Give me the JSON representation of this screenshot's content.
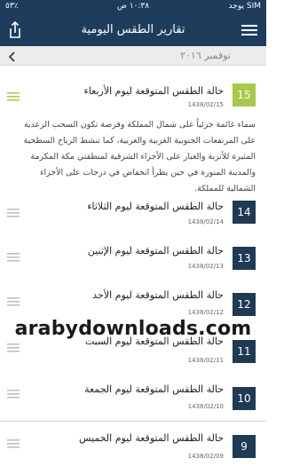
{
  "status_bar": {
    "carrier": "يوجد SIM",
    "time": "١٠:٣٨ ص",
    "battery": "٥٣٪"
  },
  "header": {
    "title": "تقارير الطقس اليومية",
    "share_icon": "share-icon",
    "menu_icon": "hamburger-menu-icon"
  },
  "month_nav": {
    "label": "نوفمبر ٢٠١٦",
    "prev_icon": "chevron-left-icon"
  },
  "colors": {
    "header_bg": "#1e3d5c",
    "active_badge": "#a9c94a",
    "badge": "#1f3a55"
  },
  "items": [
    {
      "day": "15",
      "title": "حالة الطقس المتوقعة ليوم الأربعاء",
      "date": "1438/02/15",
      "active": true
    },
    {
      "day": "14",
      "title": "حالة الطقس المتوقعة ليوم الثلاثاء",
      "date": "1438/02/14"
    },
    {
      "day": "13",
      "title": "حالة الطقس المتوقعة ليوم الإثنين",
      "date": "1438/02/13"
    },
    {
      "day": "12",
      "title": "حالة الطقس المتوقعة ليوم الأحد",
      "date": "1438/02/12"
    },
    {
      "day": "11",
      "title": "حالة الطقس المتوقعة ليوم السبت",
      "date": "1438/02/11"
    },
    {
      "day": "10",
      "title": "حالة الطقس المتوقعة ليوم الجمعة",
      "date": "1438/02/10"
    },
    {
      "day": "9",
      "title": "حالة الطقس المتوقعة ليوم الخميس",
      "date": "1438/02/09"
    }
  ],
  "expanded_description": "سماء غائمة جزئياً على شمال المملكة وفرصة تكون السحب الرعدية على المرتفعات الجنوبية الغربية والغربية، كما تنشط الرياح السطحية المثيرة للأتربة والغبار على الأجزاء الشرقية لمنطقتي مكة المكرمة والمدينة المنورة في حين يطرأ انخفاض في درجات على الأجزاء الشمالية للمملكة.",
  "watermark": "arabydownloads.com"
}
